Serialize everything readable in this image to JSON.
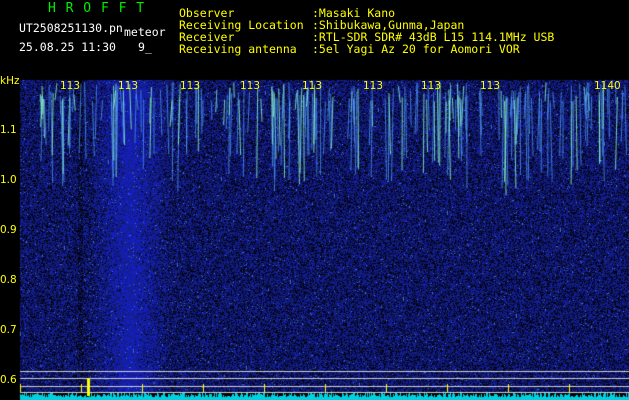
{
  "header": {
    "station": "H R O F F T",
    "filename": "UT2508251130.pn",
    "category": "meteor",
    "datetime": "25.08.25 11:30",
    "counter": "9_",
    "info_labels": [
      "Observer",
      "Receiving Location",
      "Receiver",
      "Receiving antenna"
    ],
    "info_values": [
      ":Masaki Kano",
      ":Shibukawa,Gunma,Japan",
      ":RTL-SDR SDR# 43dB L15 114.1MHz USB",
      ":5el Yagi Az 20 for Aomori VOR"
    ]
  },
  "axes": {
    "y_unit": "kHz",
    "y_ticks": [
      "1.1",
      "1.0",
      "0.9",
      "0.8",
      "0.7",
      "0.6"
    ],
    "x_ticks": [
      "113",
      "113",
      "113",
      "113",
      "113",
      "113",
      "113",
      "113",
      "1140"
    ]
  },
  "colors": {
    "background": "#000000",
    "noise": "#1020a0",
    "signal": "#80ffc0",
    "label": "#ffff00",
    "station": "#00ee00"
  }
}
